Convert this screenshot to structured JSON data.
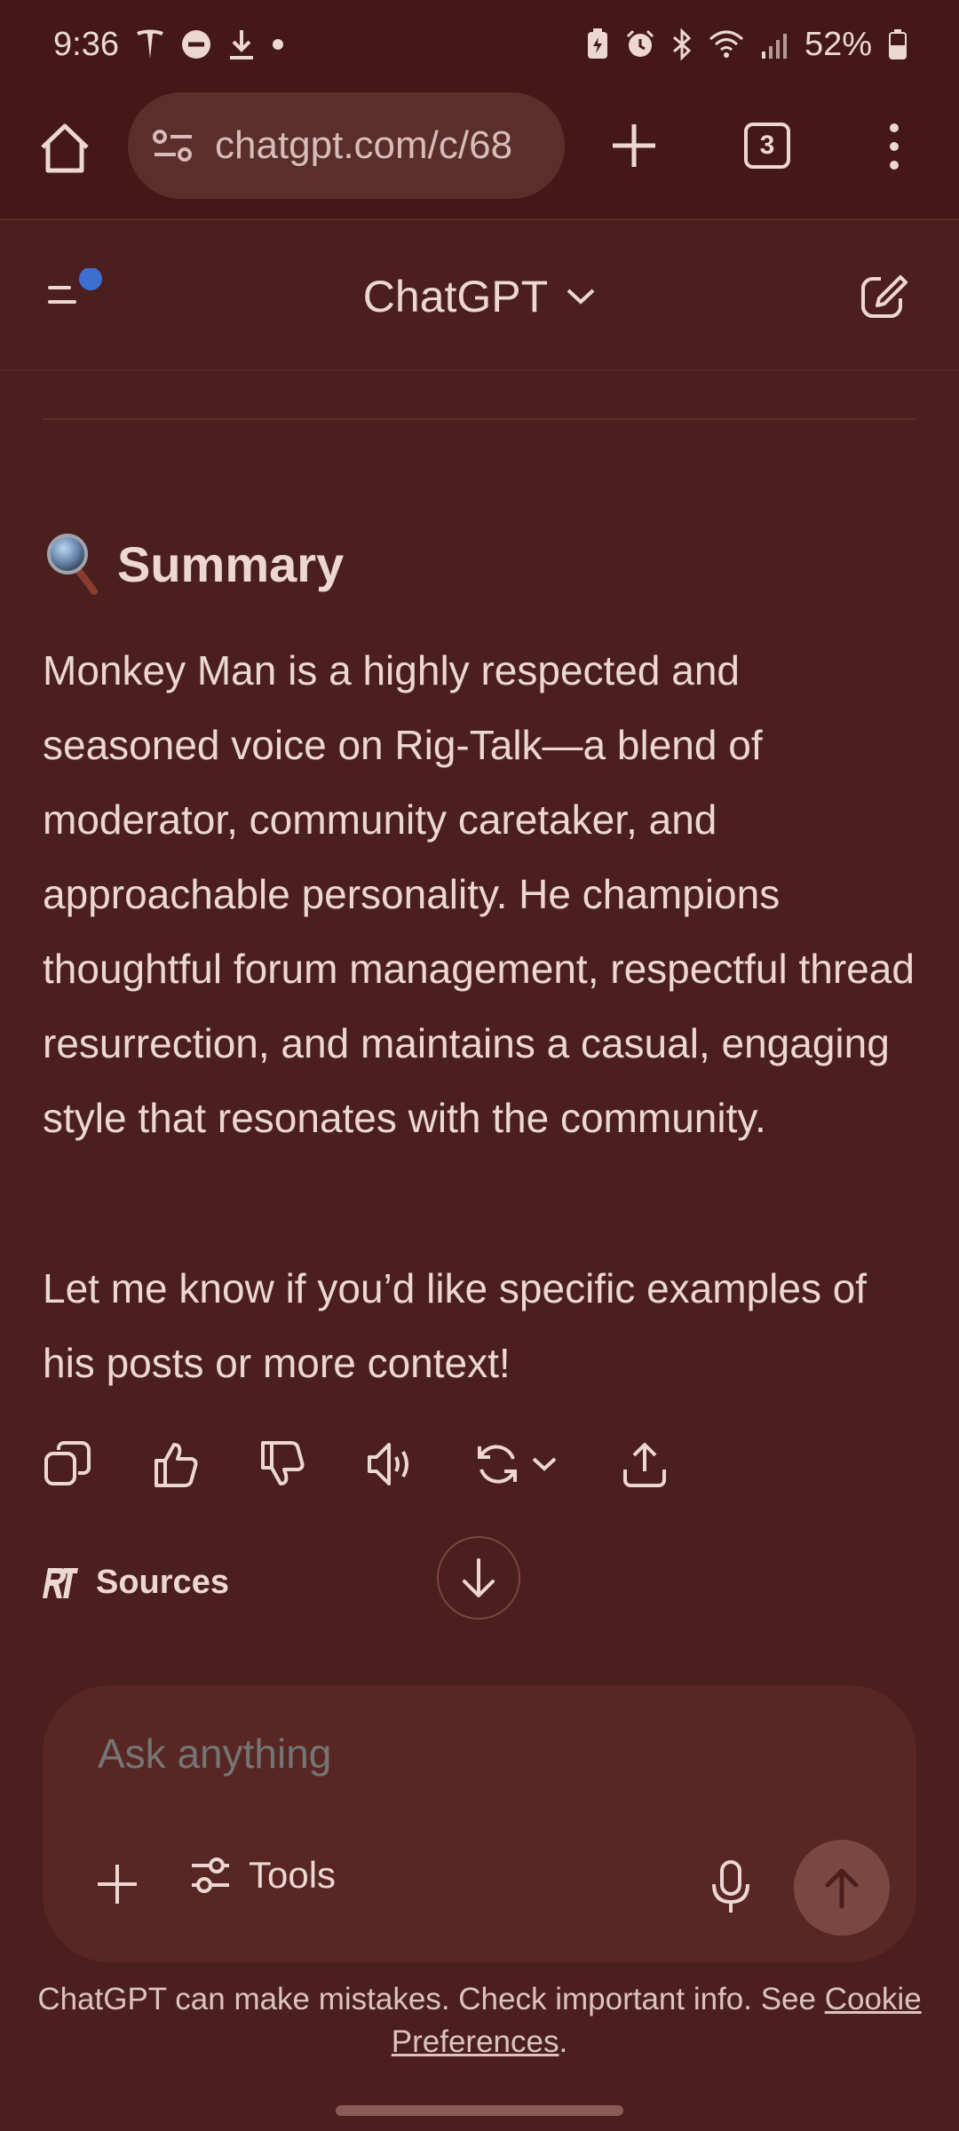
{
  "status_bar": {
    "time": "9:36",
    "battery": "52%",
    "icons_left": [
      "tesla-icon",
      "dnd-icon",
      "download-icon",
      "dot-icon"
    ],
    "icons_right": [
      "battery-saver-icon",
      "alarm-icon",
      "bluetooth-icon",
      "wifi-icon",
      "signal-icon",
      "battery-icon"
    ]
  },
  "browser": {
    "url": "chatgpt.com/c/68",
    "tab_count": "3"
  },
  "header": {
    "title": "ChatGPT"
  },
  "content": {
    "heading": "Summary",
    "paragraph_1": "Monkey Man is a highly respected and seasoned voice on Rig-Talk—a blend of moderator, community caretaker, and approachable personality. He champions thoughtful forum management, respectful thread resurrection, and maintains a casual, engaging style that resonates with the community.",
    "paragraph_2": "Let me know if you’d like specific examples of his posts or more context!",
    "sources_label": "Sources"
  },
  "composer": {
    "placeholder": "Ask anything",
    "tools_label": "Tools"
  },
  "footer": {
    "disclaimer_text": "ChatGPT can make mistakes. Check important info. See ",
    "link_text": "Cookie Preferences",
    "disclaimer_end": "."
  },
  "colors": {
    "background": "#4b1f1d",
    "bar_background": "#431816",
    "composer": "#582724",
    "text": "#ecd7d3",
    "accent_dot": "#3d6fd0"
  }
}
